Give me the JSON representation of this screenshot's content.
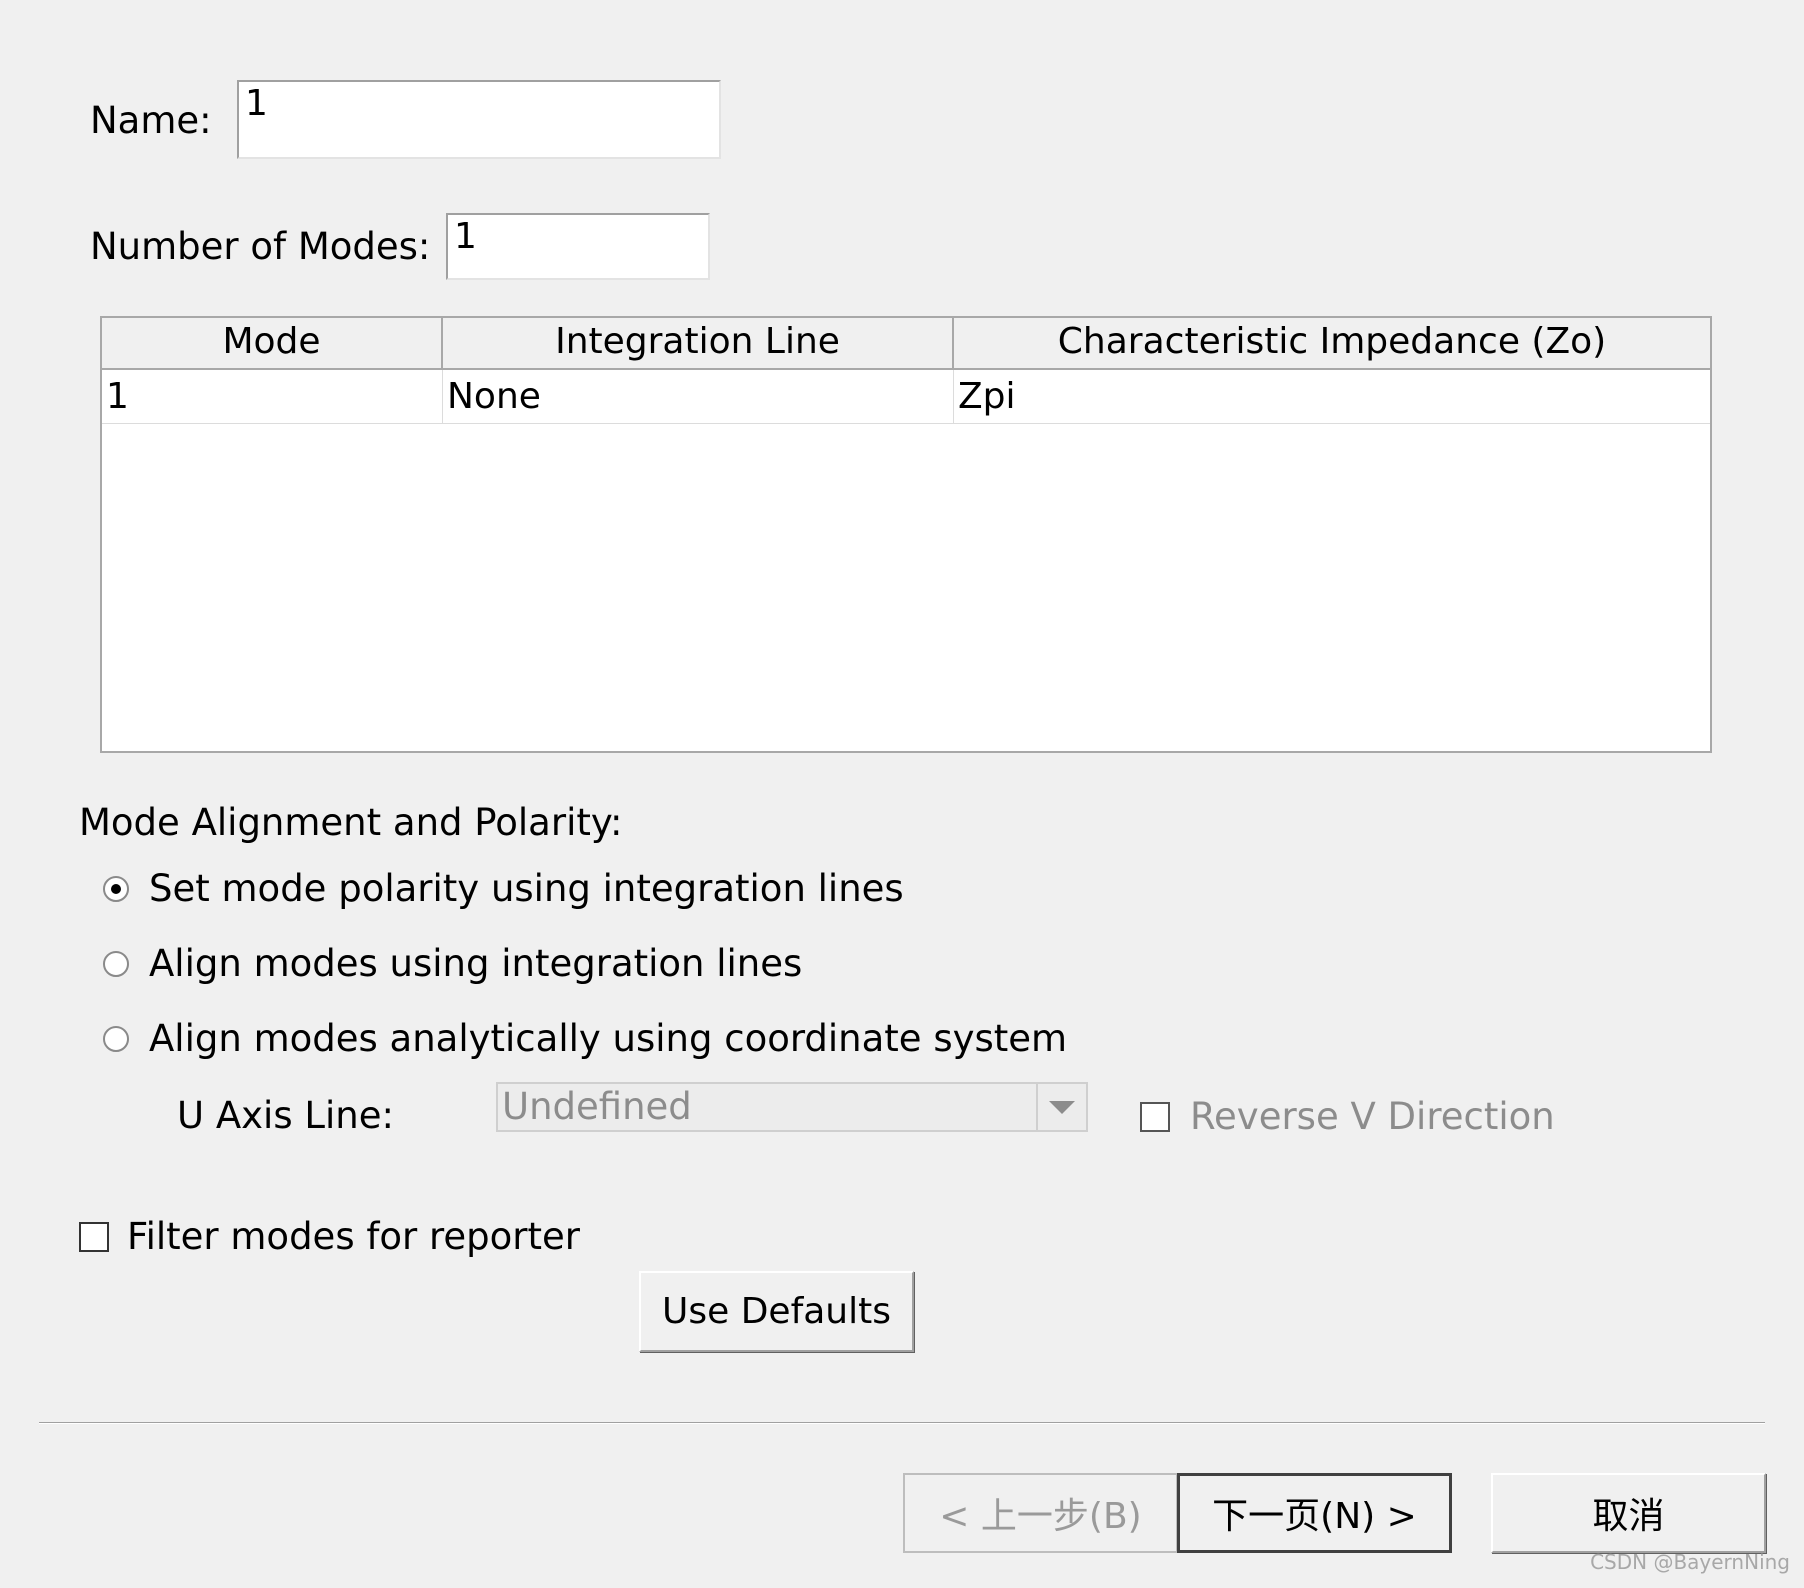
{
  "form": {
    "name_label": "Name:",
    "name_value": "1",
    "modes_label": "Number of Modes:",
    "modes_value": "1"
  },
  "table": {
    "headers": [
      "Mode",
      "Integration Line",
      "Characteristic Impedance (Zo)"
    ],
    "rows": [
      [
        "1",
        "None",
        "Zpi"
      ]
    ]
  },
  "alignment": {
    "title": "Mode Alignment and Polarity:",
    "options": [
      {
        "label": "Set mode polarity using integration lines",
        "checked": true
      },
      {
        "label": "Align modes using integration lines",
        "checked": false
      },
      {
        "label": "Align modes analytically using coordinate system",
        "checked": false
      }
    ],
    "u_axis_label": "U Axis Line:",
    "u_axis_value": "Undefined",
    "reverse_v_label": "Reverse V Direction"
  },
  "filter": {
    "label": "Filter modes for reporter"
  },
  "buttons": {
    "use_defaults": "Use Defaults",
    "back": "< 上一步(B)",
    "next": "下一页(N) >",
    "cancel": "取消"
  },
  "watermark": "CSDN @BayernNing",
  "icons": {
    "combo_arrow": "chevron-down-icon"
  }
}
